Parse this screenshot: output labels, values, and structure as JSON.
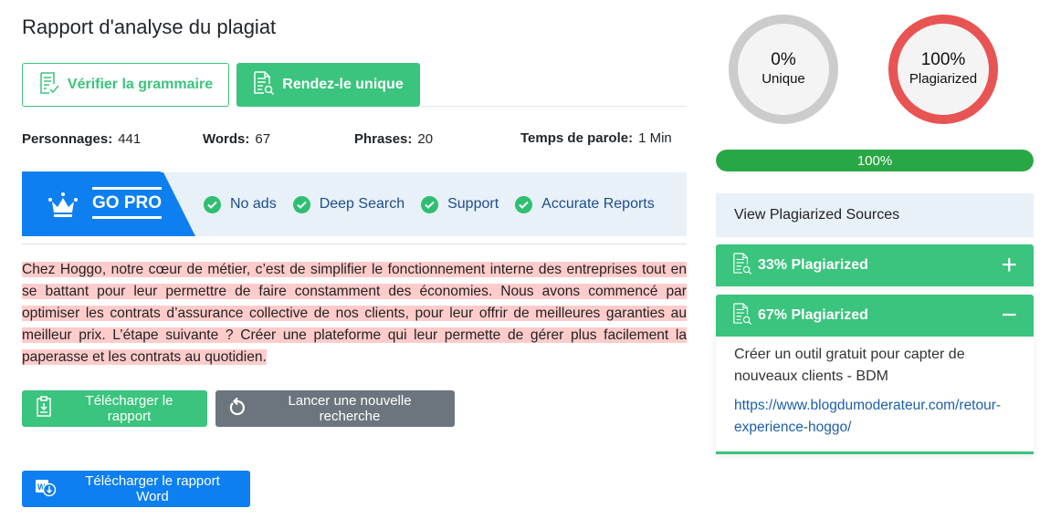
{
  "page": {
    "title": "Rapport d'analyse du plagiat"
  },
  "toolbar": {
    "check_grammar_label": "Vérifier la grammaire",
    "make_unique_label": "Rendez-le unique"
  },
  "stats": [
    {
      "label": "Personnages:",
      "value": "441"
    },
    {
      "label": "Words:",
      "value": "67"
    },
    {
      "label": "Phrases:",
      "value": "20"
    },
    {
      "label": "Temps de parole:",
      "value": "1 Min"
    }
  ],
  "gopro": {
    "label": "GO PRO",
    "features": [
      "No ads",
      "Deep Search",
      "Support",
      "Accurate Reports"
    ]
  },
  "content": {
    "text": " Chez Hoggo, notre cœur de métier, c’est de simplifier le fonctionnement interne des entreprises tout en se battant pour leur permettre de faire constamment des économies.  Nous avons commencé par optimiser les contrats d’assurance collective de nos clients, pour leur offrir de meilleures garanties au meilleur prix.  L’étape suivante ?  Créer une plateforme qui leur permette de gérer plus facilement la paperasse et les contrats au quotidien. ",
    "highlight_color": "#ffcccb"
  },
  "actions": {
    "download_report_label": "Télécharger le rapport",
    "new_search_label": "Lancer une nouvelle recherche",
    "download_word_label": "Télécharger le rapport Word"
  },
  "summary": {
    "unique": {
      "percent": "0%",
      "label": "Unique",
      "color": "#cccccc"
    },
    "plagiarized": {
      "percent": "100%",
      "label": "Plagiarized",
      "color": "#e85353"
    },
    "progress": {
      "value": 100,
      "label": "100%",
      "color": "#28a745"
    }
  },
  "sources": {
    "header": "View Plagiarized Sources",
    "items": [
      {
        "title": "33% Plagiarized",
        "toggle": "+",
        "expanded": false
      },
      {
        "title": "67% Plagiarized",
        "toggle": "−",
        "expanded": true,
        "source_title": "Créer un outil gratuit pour capter de nouveaux clients - BDM",
        "source_url": "https://www.blogdumoderateur.com/retour-experience-hoggo/"
      }
    ]
  },
  "colors": {
    "brand_green": "#3ac47d",
    "brand_blue": "#0d7ff0",
    "secondary_gray": "#6c757d",
    "link_blue": "#1c5fa8"
  }
}
